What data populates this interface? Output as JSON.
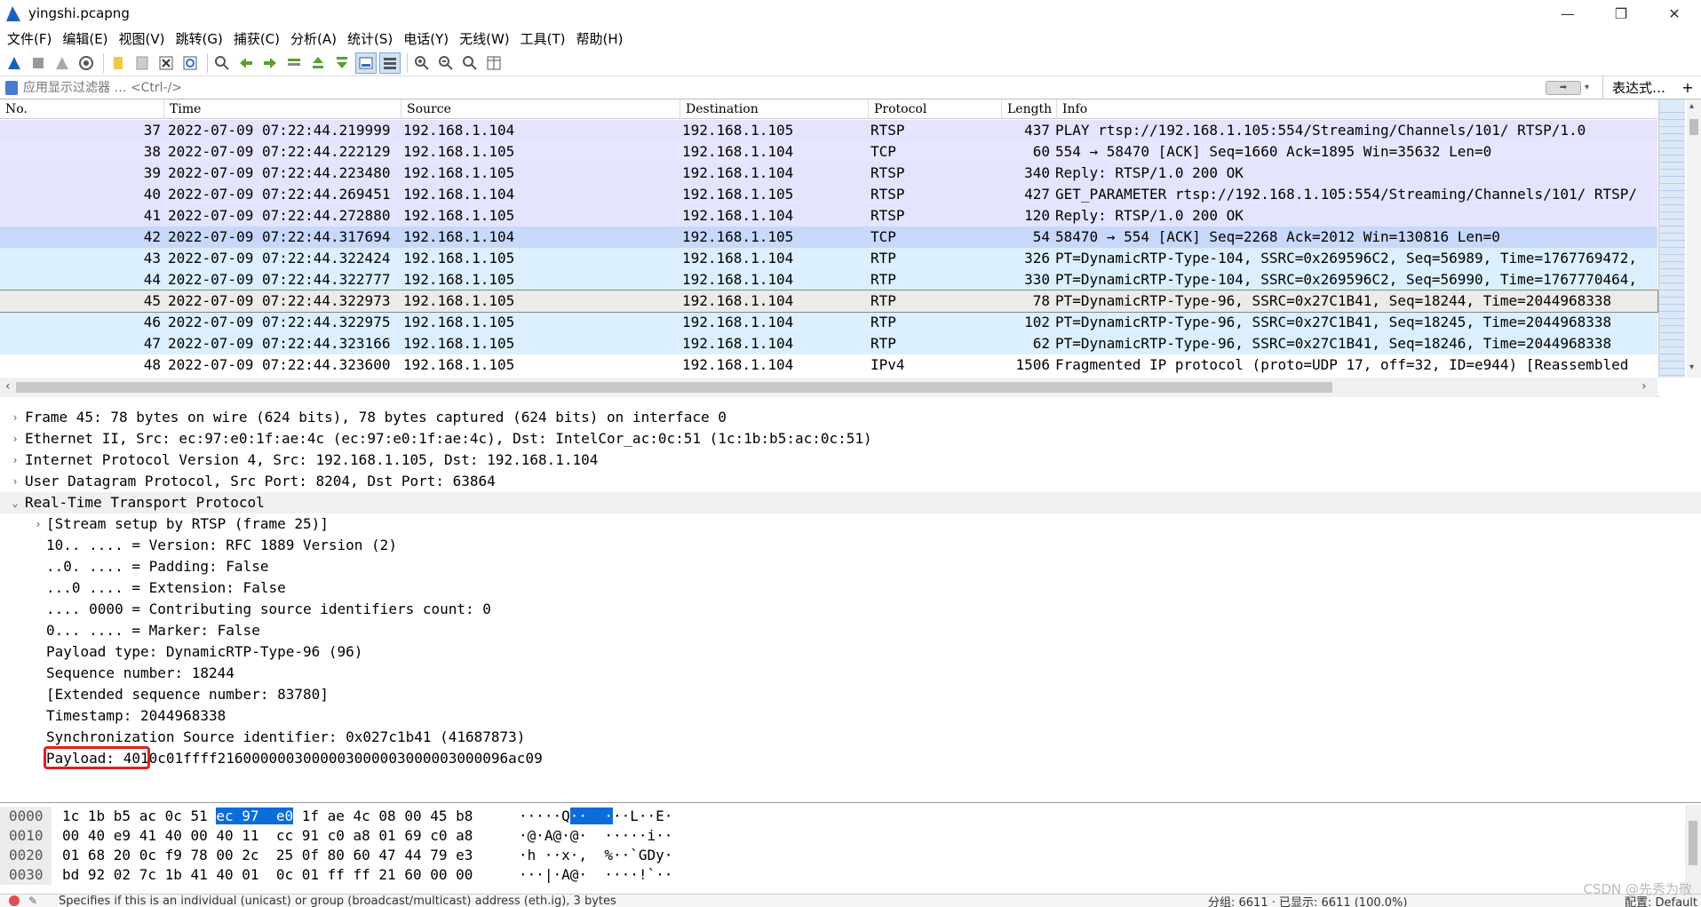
{
  "window": {
    "title": "yingshi.pcapng",
    "minimize": "—",
    "maximize": "❐",
    "close": "✕"
  },
  "menu": [
    "文件(F)",
    "编辑(E)",
    "视图(V)",
    "跳转(G)",
    "捕获(C)",
    "分析(A)",
    "统计(S)",
    "电话(Y)",
    "无线(W)",
    "工具(T)",
    "帮助(H)"
  ],
  "filter": {
    "placeholder": "应用显示过滤器 … <Ctrl-/>",
    "expression_label": "表达式…",
    "add_label": "+"
  },
  "packet_list": {
    "columns": [
      "No.",
      "Time",
      "Source",
      "Destination",
      "Protocol",
      "Length",
      "Info"
    ],
    "rows": [
      {
        "no": "37",
        "time": "2022-07-09 07:22:44.219999",
        "src": "192.168.1.104",
        "dst": "192.168.1.105",
        "proto": "RTSP",
        "len": "437",
        "info": "PLAY rtsp://192.168.1.105:554/Streaming/Channels/101/ RTSP/1.0"
      },
      {
        "no": "38",
        "time": "2022-07-09 07:22:44.222129",
        "src": "192.168.1.105",
        "dst": "192.168.1.104",
        "proto": "TCP",
        "len": "60",
        "info": "554 → 58470 [ACK] Seq=1660 Ack=1895 Win=35632 Len=0"
      },
      {
        "no": "39",
        "time": "2022-07-09 07:22:44.223480",
        "src": "192.168.1.105",
        "dst": "192.168.1.104",
        "proto": "RTSP",
        "len": "340",
        "info": "Reply: RTSP/1.0 200 OK"
      },
      {
        "no": "40",
        "time": "2022-07-09 07:22:44.269451",
        "src": "192.168.1.104",
        "dst": "192.168.1.105",
        "proto": "RTSP",
        "len": "427",
        "info": "GET_PARAMETER rtsp://192.168.1.105:554/Streaming/Channels/101/ RTSP/"
      },
      {
        "no": "41",
        "time": "2022-07-09 07:22:44.272880",
        "src": "192.168.1.105",
        "dst": "192.168.1.104",
        "proto": "RTSP",
        "len": "120",
        "info": "Reply: RTSP/1.0 200 OK"
      },
      {
        "no": "42",
        "time": "2022-07-09 07:22:44.317694",
        "src": "192.168.1.104",
        "dst": "192.168.1.105",
        "proto": "TCP",
        "len": "54",
        "info": "58470 → 554 [ACK] Seq=2268 Ack=2012 Win=130816 Len=0"
      },
      {
        "no": "43",
        "time": "2022-07-09 07:22:44.322424",
        "src": "192.168.1.105",
        "dst": "192.168.1.104",
        "proto": "RTP",
        "len": "326",
        "info": "PT=DynamicRTP-Type-104, SSRC=0x269596C2, Seq=56989, Time=1767769472,"
      },
      {
        "no": "44",
        "time": "2022-07-09 07:22:44.322777",
        "src": "192.168.1.105",
        "dst": "192.168.1.104",
        "proto": "RTP",
        "len": "330",
        "info": "PT=DynamicRTP-Type-104, SSRC=0x269596C2, Seq=56990, Time=1767770464,"
      },
      {
        "no": "45",
        "time": "2022-07-09 07:22:44.322973",
        "src": "192.168.1.105",
        "dst": "192.168.1.104",
        "proto": "RTP",
        "len": "78",
        "info": "PT=DynamicRTP-Type-96, SSRC=0x27C1B41, Seq=18244, Time=2044968338"
      },
      {
        "no": "46",
        "time": "2022-07-09 07:22:44.322975",
        "src": "192.168.1.105",
        "dst": "192.168.1.104",
        "proto": "RTP",
        "len": "102",
        "info": "PT=DynamicRTP-Type-96, SSRC=0x27C1B41, Seq=18245, Time=2044968338"
      },
      {
        "no": "47",
        "time": "2022-07-09 07:22:44.323166",
        "src": "192.168.1.105",
        "dst": "192.168.1.104",
        "proto": "RTP",
        "len": "62",
        "info": "PT=DynamicRTP-Type-96, SSRC=0x27C1B41, Seq=18246, Time=2044968338"
      },
      {
        "no": "48",
        "time": "2022-07-09 07:22:44.323600",
        "src": "192.168.1.105",
        "dst": "192.168.1.104",
        "proto": "IPv4",
        "len": "1506",
        "info": "Fragmented IP protocol (proto=UDP 17, off=32, ID=e944) [Reassembled"
      }
    ]
  },
  "details": {
    "frame": "Frame 45: 78 bytes on wire (624 bits), 78 bytes captured (624 bits) on interface 0",
    "ethernet": "Ethernet II, Src: ec:97:e0:1f:ae:4c (ec:97:e0:1f:ae:4c), Dst: IntelCor_ac:0c:51 (1c:1b:b5:ac:0c:51)",
    "ip": "Internet Protocol Version 4, Src: 192.168.1.105, Dst: 192.168.1.104",
    "udp": "User Datagram Protocol, Src Port: 8204, Dst Port: 63864",
    "rtp": "Real-Time Transport Protocol",
    "rtp_children": [
      "[Stream setup by RTSP (frame 25)]",
      "10.. .... = Version: RFC 1889 Version (2)",
      "..0. .... = Padding: False",
      "...0 .... = Extension: False",
      ".... 0000 = Contributing source identifiers count: 0",
      "0... .... = Marker: False",
      "Payload type: DynamicRTP-Type-96 (96)",
      "Sequence number: 18244",
      "[Extended sequence number: 83780]",
      "Timestamp: 2044968338",
      "Synchronization Source identifier: 0x027c1b41 (41687873)",
      "Payload: 4010c01ffff2160000003000003000003000003000096ac09"
    ]
  },
  "bytes": {
    "rows": [
      {
        "off": "0000",
        "hex_a": "1c 1b b5 ac 0c 51 ",
        "hex_hl": "ec 97  e0",
        "hex_b": " 1f ae 4c 08 00 45 b8",
        "asc_a": "·····Q",
        "asc_hl": "··  ·",
        "asc_b": "··L··E·"
      },
      {
        "off": "0010",
        "hex_a": "00 40 e9 41 40 00 40 11  cc 91 c0 a8 01 69 c0 a8",
        "hex_hl": "",
        "hex_b": "",
        "asc_a": "·@·A@·@·  ·····i··",
        "asc_hl": "",
        "asc_b": ""
      },
      {
        "off": "0020",
        "hex_a": "01 68 20 0c f9 78 00 2c  25 0f 80 60 47 44 79 e3",
        "hex_hl": "",
        "hex_b": "",
        "asc_a": "·h ··x·,  %··`GDy·",
        "asc_hl": "",
        "asc_b": ""
      },
      {
        "off": "0030",
        "hex_a": "bd 92 02 7c 1b 41 40 01  0c 01 ff ff 21 60 00 00",
        "hex_hl": "",
        "hex_b": "",
        "asc_a": "···|·A@·  ····!`··",
        "asc_hl": "",
        "asc_b": ""
      }
    ]
  },
  "status": {
    "message": "Specifies if this is an individual (unicast) or group (broadcast/multicast) address (eth.ig), 3 bytes",
    "counts": "分组: 6611 · 已显示: 6611 (100.0%)",
    "profile": "配置: Default",
    "watermark": "CSDN @先秀为敬"
  },
  "colors": {
    "rtsp": "#e4e4ff",
    "rtp": "#dcefff",
    "tcp_ack": "#c7d8fb",
    "selected": "#ebebeb",
    "highlight": "#0a6dd8",
    "annotation": "#e02020"
  }
}
